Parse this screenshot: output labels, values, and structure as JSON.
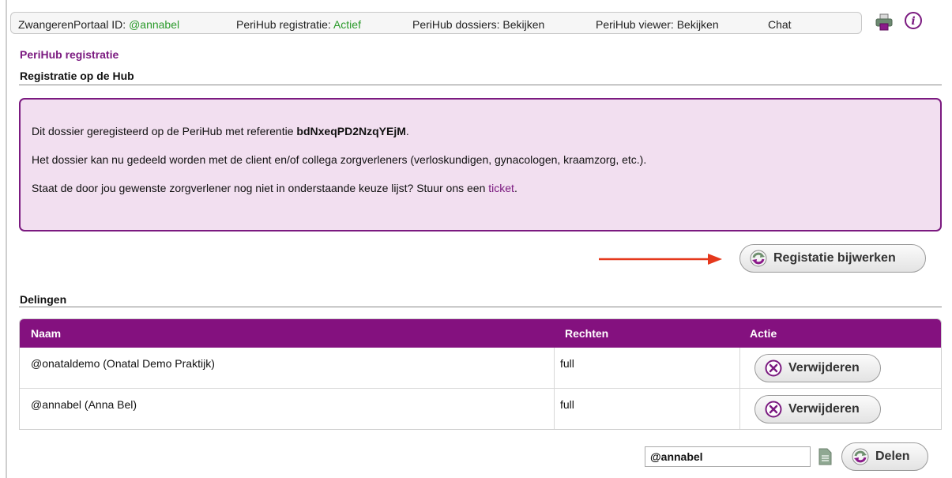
{
  "topbar": {
    "portal_label": "ZwangerenPortaal ID:",
    "portal_id": "@annabel",
    "registratie_label": "PeriHub registratie:",
    "registratie_status": "Actief",
    "dossiers_label": "PeriHub dossiers: Bekijken",
    "viewer_label": "PeriHub viewer: Bekijken",
    "chat_label": "Chat",
    "icons": [
      "printer-icon",
      "info-icon"
    ]
  },
  "page": {
    "title": "PeriHub registratie",
    "section_registratie": "Registratie op de Hub",
    "section_delingen": "Delingen"
  },
  "infobox": {
    "line1_prefix": "Dit dossier geregisteerd op de PeriHub met referentie ",
    "line1_ref": "bdNxeqPD2NzqYEjM",
    "line1_suffix": ".",
    "line2": "Het dossier kan nu gedeeld worden met de client en/of collega zorgverleners (verloskundigen, gynacologen, kraamzorg, etc.).",
    "line3_prefix": "Staat de door jou gewenste zorgverlener nog niet in onderstaande keuze lijst? Stuur ons een ",
    "line3_link": "ticket",
    "line3_suffix": "."
  },
  "update_button": {
    "label": "Registatie bijwerken",
    "icon": "refresh-icon"
  },
  "table": {
    "headers": {
      "naam": "Naam",
      "rechten": "Rechten",
      "actie": "Actie"
    },
    "rows": [
      {
        "naam": "@onataldemo (Onatal Demo Praktijk)",
        "rechten": "full",
        "action_label": "Verwijderen"
      },
      {
        "naam": "@annabel (Anna Bel)",
        "rechten": "full",
        "action_label": "Verwijderen"
      }
    ]
  },
  "share": {
    "input_value": "@annabel",
    "button_label": "Delen",
    "icons": [
      "document-icon",
      "refresh-icon"
    ]
  },
  "colors": {
    "brand_purple": "#84117f",
    "status_green": "#2a9a2a",
    "infobox_bg": "#f2dff0",
    "arrow_red": "#e5381c"
  }
}
